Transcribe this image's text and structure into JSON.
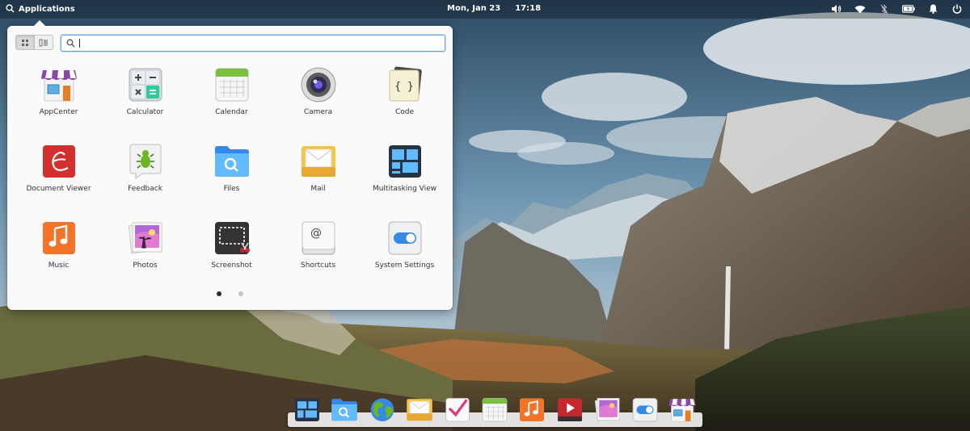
{
  "panel": {
    "applications_label": "Applications",
    "date": "Mon, Jan 23",
    "time": "17:18",
    "indicators": [
      "volume-icon",
      "wifi-icon",
      "bluetooth-off-icon",
      "battery-icon",
      "notifications-icon",
      "power-icon"
    ]
  },
  "menu": {
    "search_value": "",
    "view_modes": [
      "grid-view-icon",
      "category-view-icon"
    ],
    "apps": [
      {
        "label": "AppCenter",
        "icon": "appcenter-icon"
      },
      {
        "label": "Calculator",
        "icon": "calculator-icon"
      },
      {
        "label": "Calendar",
        "icon": "calendar-icon"
      },
      {
        "label": "Camera",
        "icon": "camera-icon"
      },
      {
        "label": "Code",
        "icon": "code-icon"
      },
      {
        "label": "Document Viewer",
        "icon": "document-viewer-icon"
      },
      {
        "label": "Feedback",
        "icon": "feedback-icon"
      },
      {
        "label": "Files",
        "icon": "files-icon"
      },
      {
        "label": "Mail",
        "icon": "mail-icon"
      },
      {
        "label": "Multitasking View",
        "icon": "multitasking-view-icon"
      },
      {
        "label": "Music",
        "icon": "music-icon"
      },
      {
        "label": "Photos",
        "icon": "photos-icon"
      },
      {
        "label": "Screenshot",
        "icon": "screenshot-icon"
      },
      {
        "label": "Shortcuts",
        "icon": "shortcuts-icon"
      },
      {
        "label": "System Settings",
        "icon": "system-settings-icon"
      }
    ],
    "pages": 2,
    "current_page": 1
  },
  "dock": {
    "items": [
      "multitasking-view-icon",
      "files-icon",
      "web-browser-icon",
      "mail-icon",
      "tasks-icon",
      "calendar-icon",
      "music-icon",
      "videos-icon",
      "photos-icon",
      "system-settings-icon",
      "appcenter-icon"
    ]
  }
}
